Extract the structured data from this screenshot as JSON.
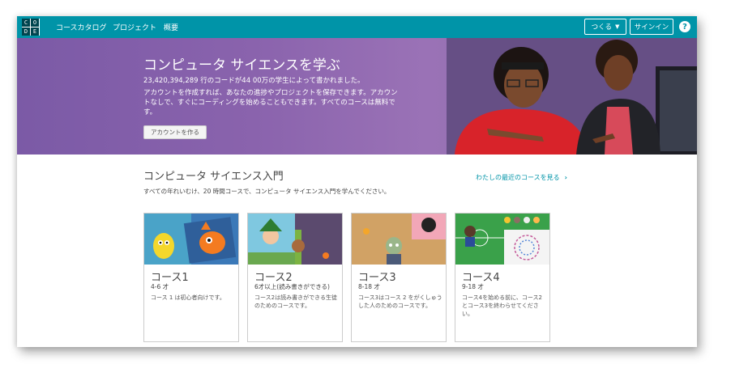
{
  "logo": {
    "letters": [
      "C",
      "O",
      "D",
      "E"
    ]
  },
  "nav": {
    "links": [
      "コースカタログ",
      "プロジェクト",
      "概要"
    ],
    "create_label": "つくる",
    "signin_label": "サインイン",
    "help_symbol": "?"
  },
  "hero": {
    "title": "コンピュータ サイエンスを学ぶ",
    "stat": "23,420,394,289 行のコードが44 00万の学生によって書かれました。",
    "desc": "アカウントを作成すれば、あなたの進捗やプロジェクトを保存できます。アカウントなしで、すぐにコーディングを始めることもできます。すべてのコースは無料です。",
    "account_button": "アカウントを作る"
  },
  "section": {
    "title": "コンピュータ サイエンス入門",
    "subtitle": "すべての年れいむけ、20 時間コースで、コンピュータ サイエンス入門を学んでください。",
    "recent_link": "わたしの最近のコースを見る"
  },
  "courses": [
    {
      "name": "コース1",
      "age": "4-6 才",
      "desc": "コース 1 は初心者向けです。"
    },
    {
      "name": "コース2",
      "age": "6才以上(読み書きができる)",
      "desc": "コース2は読み書きができる生徒のためのコースです。"
    },
    {
      "name": "コース3",
      "age": "8-18 才",
      "desc": "コース3はコース 2 をがくしゅうした人のためのコースです。"
    },
    {
      "name": "コース4",
      "age": "9-18 才",
      "desc": "コース4を始める前に、コース2とコース3を終わらせてください。"
    }
  ],
  "colors": {
    "nav_bg": "#0094a8",
    "hero_bg": "#8a63ad",
    "link": "#0094a8"
  }
}
